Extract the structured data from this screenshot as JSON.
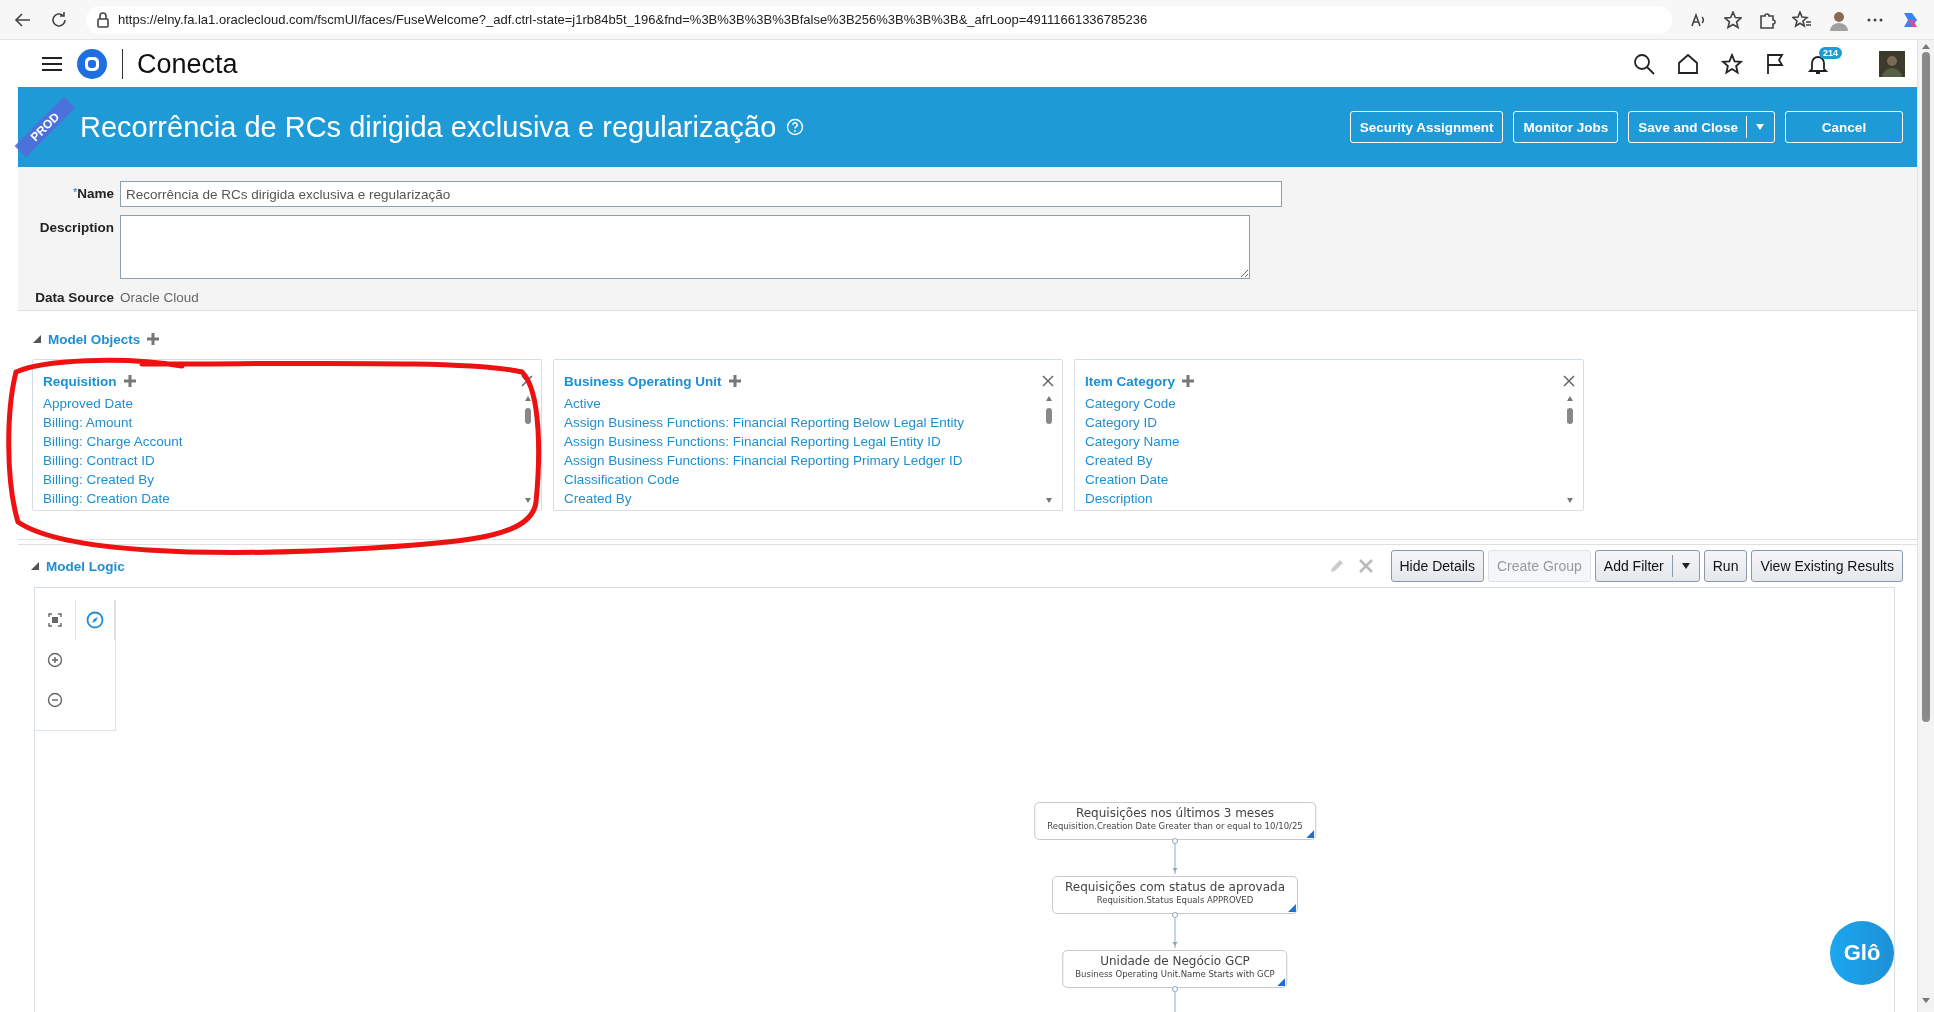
{
  "browser": {
    "url": "https://elny.fa.la1.oraclecloud.com/fscmUI/faces/FuseWelcome?_adf.ctrl-state=j1rb84b5t_196&fnd=%3B%3B%3B%3Bfalse%3B256%3B%3B%3B&_afrLoop=49111661336785236"
  },
  "app": {
    "name": "Conecta",
    "environment": "PROD",
    "notification_count": "214"
  },
  "page": {
    "title": "Recorrência de RCs dirigida exclusiva e regularização",
    "buttons": [
      {
        "label": "Security Assignment",
        "kind": "plain"
      },
      {
        "label": "Monitor Jobs",
        "kind": "plain"
      },
      {
        "label": "Save and Close",
        "kind": "split"
      },
      {
        "label": "Cancel",
        "kind": "plain"
      }
    ]
  },
  "form": {
    "required_mark": "*",
    "name_label": "Name",
    "name_value": "Recorrência de RCs dirigida exclusiva e regularização",
    "description_label": "Description",
    "data_source_label": "Data Source",
    "data_source_value": "Oracle Cloud"
  },
  "model_objects": {
    "title": "Model Objects",
    "expanded": true,
    "objects": [
      {
        "name": "Requisition",
        "fields": [
          "Approved Date",
          "Billing: Amount",
          "Billing: Charge Account",
          "Billing: Contract ID",
          "Billing: Created By",
          "Billing: Creation Date"
        ]
      },
      {
        "name": "Business Operating Unit",
        "fields": [
          "Active",
          "Assign Business Functions: Financial Reporting Below Legal Entity",
          "Assign Business Functions: Financial Reporting Legal Entity ID",
          "Assign Business Functions: Financial Reporting Primary Ledger ID",
          "Classification Code",
          "Created By"
        ]
      },
      {
        "name": "Item Category",
        "fields": [
          "Category Code",
          "Category ID",
          "Category Name",
          "Created By",
          "Creation Date",
          "Description"
        ]
      }
    ]
  },
  "model_logic": {
    "title": "Model Logic",
    "expanded": true,
    "buttons": [
      {
        "label": "Hide Details",
        "kind": "plain",
        "disabled": false
      },
      {
        "label": "Create Group",
        "kind": "plain",
        "disabled": true
      },
      {
        "label": "Add Filter",
        "kind": "split",
        "disabled": false
      },
      {
        "label": "Run",
        "kind": "plain",
        "disabled": false
      },
      {
        "label": "View Existing Results",
        "kind": "plain",
        "disabled": false
      }
    ],
    "nodes": [
      {
        "title": "Requisições nos últimos 3 meses",
        "condition": "Requisition.Creation Date Greater than or equal to 10/10/25"
      },
      {
        "title": "Requisições com status de aprovada",
        "condition": "Requisition.Status Equals APPROVED"
      },
      {
        "title": "Unidade de Negócio GCP",
        "condition": "Business Operating Unit.Name Starts with GCP"
      }
    ]
  },
  "assistant": {
    "label": "Glô"
  }
}
